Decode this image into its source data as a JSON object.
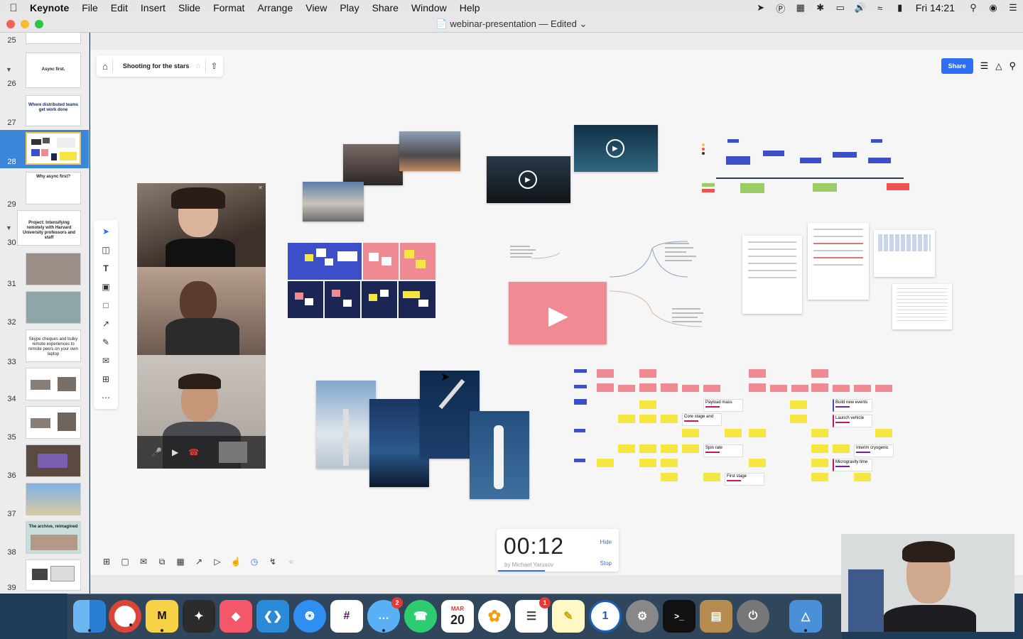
{
  "menubar": {
    "app_name": "Keynote",
    "items": [
      "File",
      "Edit",
      "Insert",
      "Slide",
      "Format",
      "Arrange",
      "View",
      "Play",
      "Share",
      "Window",
      "Help"
    ],
    "clock": "Fri 14:21"
  },
  "window": {
    "title": "webinar-presentation — Edited"
  },
  "sidebar": {
    "slides": [
      {
        "num": "25",
        "text": ""
      },
      {
        "num": "26",
        "text": "Async first."
      },
      {
        "num": "27",
        "text": "Where distributed teams get work done"
      },
      {
        "num": "28",
        "text": ""
      },
      {
        "num": "29",
        "text": "Why async first?"
      },
      {
        "num": "30",
        "text": "Project: Intensifying remotely with Harvard University professors and staff"
      },
      {
        "num": "31",
        "text": ""
      },
      {
        "num": "32",
        "text": ""
      },
      {
        "num": "33",
        "text": "Skype cheques and bulky remote experiences to remote peers on your own laptop"
      },
      {
        "num": "34",
        "text": ""
      },
      {
        "num": "35",
        "text": ""
      },
      {
        "num": "36",
        "text": ""
      },
      {
        "num": "37",
        "text": ""
      },
      {
        "num": "38",
        "text": "The archive, reimagined"
      },
      {
        "num": "39",
        "text": ""
      }
    ],
    "selected": "28"
  },
  "miro": {
    "board_title": "Shooting for the stars",
    "share_label": "Share",
    "payload_cards": [
      "Payload mass",
      "Core stage and",
      "Spin rate",
      "First stage",
      "Build new events",
      "Launch vehicle",
      "Interim cryogenic",
      "Microgravity time"
    ]
  },
  "timer": {
    "time": "00:12",
    "by": "by Michael Yarusov",
    "hide_label": "Hide",
    "stop_label": "Stop"
  },
  "dock": {
    "calendar_month": "MAR",
    "calendar_day": "20",
    "messages_badge": "2",
    "reminders_badge": "1"
  },
  "colors": {
    "accent": "#2d6ef2",
    "selected_slide": "#3b86d8",
    "sticky_yellow": "#f5e642",
    "sticky_pink": "#ef8a93"
  }
}
